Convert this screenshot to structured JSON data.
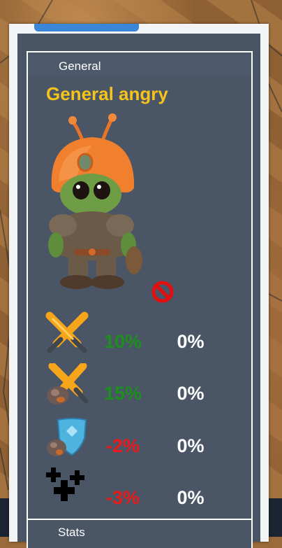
{
  "general_panel": {
    "section_label": "General",
    "general_name": "General angry",
    "portrait_icon": "alien-warrior-portrait",
    "status_icon": "prohibited-icon",
    "bonuses": [
      {
        "icon": "crossed-swords-icon",
        "bonus": "10%",
        "value": "0%",
        "bonus_sign": "positive"
      },
      {
        "icon": "swords-rock-icon",
        "bonus": "15%",
        "value": "0%",
        "bonus_sign": "positive"
      },
      {
        "icon": "shield-rock-icon",
        "bonus": "-2%",
        "value": "0%",
        "bonus_sign": "negative"
      },
      {
        "icon": "plus-crosses-icon",
        "bonus": "-3%",
        "value": "0%",
        "bonus_sign": "negative"
      }
    ]
  },
  "stats_section": {
    "label": "Stats"
  },
  "colors": {
    "name_gold": "#f6c31c",
    "positive_green": "#1e8f1e",
    "negative_red": "#e81b1b",
    "panel_slate": "#495565",
    "tab_blue": "#3a86d8"
  }
}
